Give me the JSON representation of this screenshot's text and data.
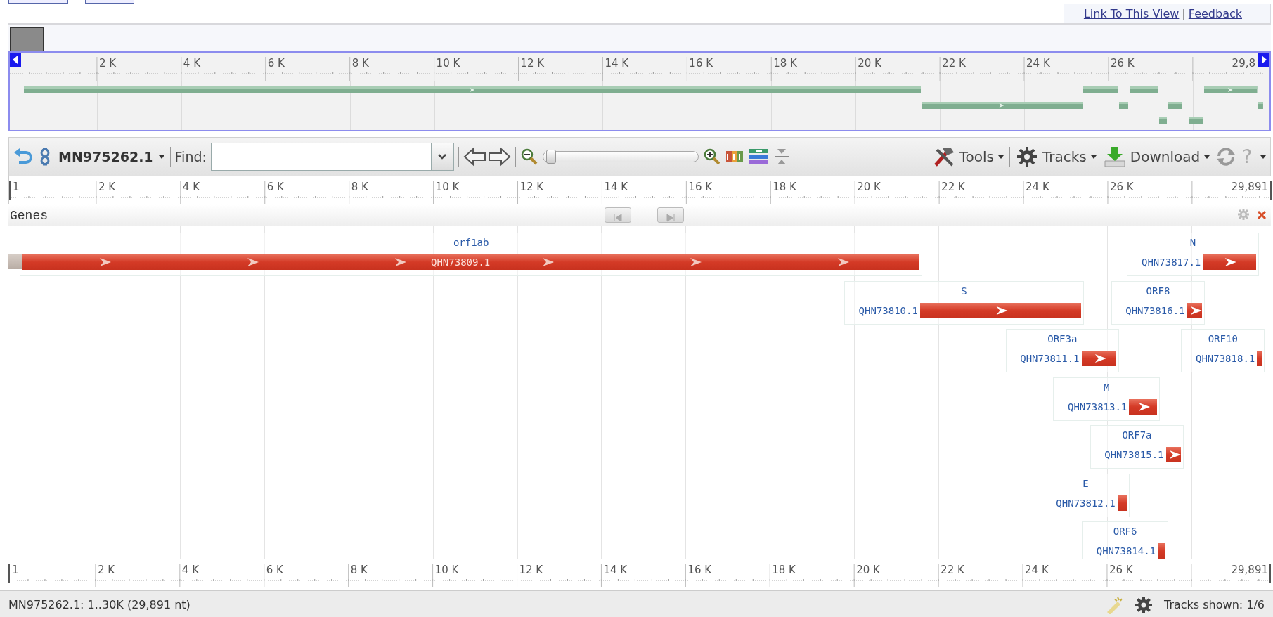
{
  "header_links": {
    "items": [
      {
        "text": "Link To This View"
      },
      {
        "text": "Feedback"
      }
    ],
    "separator": "|"
  },
  "overview": {
    "ruler": {
      "tick_labels": [
        "2 K",
        "4 K",
        "6 K",
        "8 K",
        "10 K",
        "12 K",
        "14 K",
        "16 K",
        "18 K",
        "20 K",
        "22 K",
        "24 K",
        "26 K"
      ],
      "end_label": "29,8"
    }
  },
  "toolbar": {
    "sequence": "MN975262.1",
    "find_label": "Find:",
    "zoom_slider": {
      "level": 0.02
    },
    "menus": [
      {
        "label": "Tools",
        "kind": "tools"
      },
      {
        "label": "Tracks",
        "kind": "tracks"
      },
      {
        "label": "Download",
        "kind": "download"
      }
    ],
    "help": "?"
  },
  "ruler": {
    "start_label": "1",
    "tick_labels": [
      "2 K",
      "4 K",
      "6 K",
      "8 K",
      "10 K",
      "12 K",
      "14 K",
      "16 K",
      "18 K",
      "20 K",
      "22 K",
      "24 K",
      "26 K"
    ],
    "end_label": "29,891"
  },
  "track": {
    "title": "Genes",
    "genes": [
      {
        "name": "orf1ab",
        "protein": "QHN73809.1"
      },
      {
        "name": "N",
        "protein": "QHN73817.1"
      },
      {
        "name": "S",
        "protein": "QHN73810.1"
      },
      {
        "name": "ORF8",
        "protein": "QHN73816.1"
      },
      {
        "name": "ORF3a",
        "protein": "QHN73811.1"
      },
      {
        "name": "ORF10",
        "protein": "QHN73818.1"
      },
      {
        "name": "M",
        "protein": "QHN73813.1"
      },
      {
        "name": "ORF7a",
        "protein": "QHN73815.1"
      },
      {
        "name": "E",
        "protein": "QHN73812.1"
      },
      {
        "name": "ORF6",
        "protein": "QHN73814.1"
      }
    ]
  },
  "bottom_ruler": {
    "start_label": "1",
    "tick_labels": [
      "2 K",
      "4 K",
      "6 K",
      "8 K",
      "10 K",
      "12 K",
      "14 K",
      "16 K",
      "18 K",
      "20 K",
      "22 K",
      "24 K",
      "26 K"
    ],
    "end_label": "29,891"
  },
  "status_bar": {
    "text": "MN975262.1: 1..30K (29,891 nt)",
    "tracks_shown": "Tracks shown: 1/6"
  }
}
